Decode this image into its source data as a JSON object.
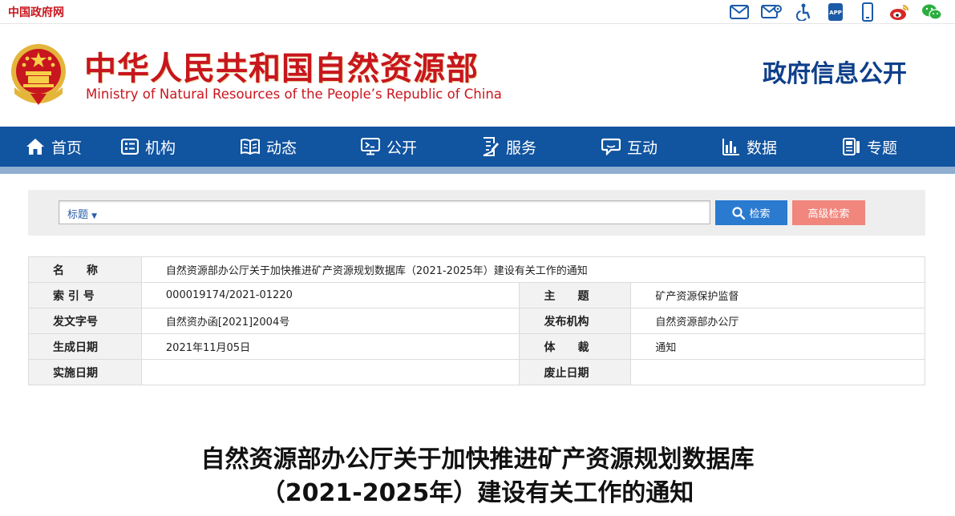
{
  "topbar": {
    "site_link": "中国政府网",
    "icons": [
      "mail-icon",
      "mail-settings-icon",
      "accessibility-icon",
      "app-icon",
      "mobile-icon",
      "weibo-icon",
      "wechat-icon"
    ]
  },
  "header": {
    "title_cn": "中华人民共和国自然资源部",
    "title_en": "Ministry of Natural Resources of the People’s Republic of China",
    "section": "政府信息公开"
  },
  "nav": {
    "items": [
      {
        "label": "首页",
        "icon": "home-icon"
      },
      {
        "label": "机构",
        "icon": "organization-icon"
      },
      {
        "label": "动态",
        "icon": "book-icon"
      },
      {
        "label": "公开",
        "icon": "monitor-icon"
      },
      {
        "label": "服务",
        "icon": "document-edit-icon"
      },
      {
        "label": "互动",
        "icon": "chat-icon"
      },
      {
        "label": "数据",
        "icon": "bar-chart-icon"
      },
      {
        "label": "专题",
        "icon": "topic-icon"
      }
    ]
  },
  "search": {
    "scope": "标题",
    "query": "",
    "search_label": "检索",
    "advanced_label": "高级检索"
  },
  "meta": {
    "name_label": "名　　称",
    "name_value": "自然资源部办公厅关于加快推进矿产资源规划数据库（2021-2025年）建设有关工作的通知",
    "index_label": "索 引 号",
    "index_value": "000019174/2021-01220",
    "topic_label": "主　　题",
    "topic_value": "矿产资源保护监督",
    "doc_no_label": "发文字号",
    "doc_no_value": "自然资办函[2021]2004号",
    "publisher_label": "发布机构",
    "publisher_value": "自然资源部办公厅",
    "created_label": "生成日期",
    "created_value": "2021年11月05日",
    "genre_label": "体　　裁",
    "genre_value": "通知",
    "effective_label": "实施日期",
    "effective_value": "",
    "expiry_label": "废止日期",
    "expiry_value": ""
  },
  "article": {
    "title_line1": "自然资源部办公厅关于加快推进矿产资源规划数据库",
    "title_line2": "（2021-2025年）建设有关工作的通知"
  },
  "colors": {
    "brand_red": "#c8161e",
    "nav_blue": "#1154a0",
    "section_blue": "#0e3f8a",
    "search_blue": "#2a7ad0",
    "advanced_pink": "#f0867c"
  }
}
